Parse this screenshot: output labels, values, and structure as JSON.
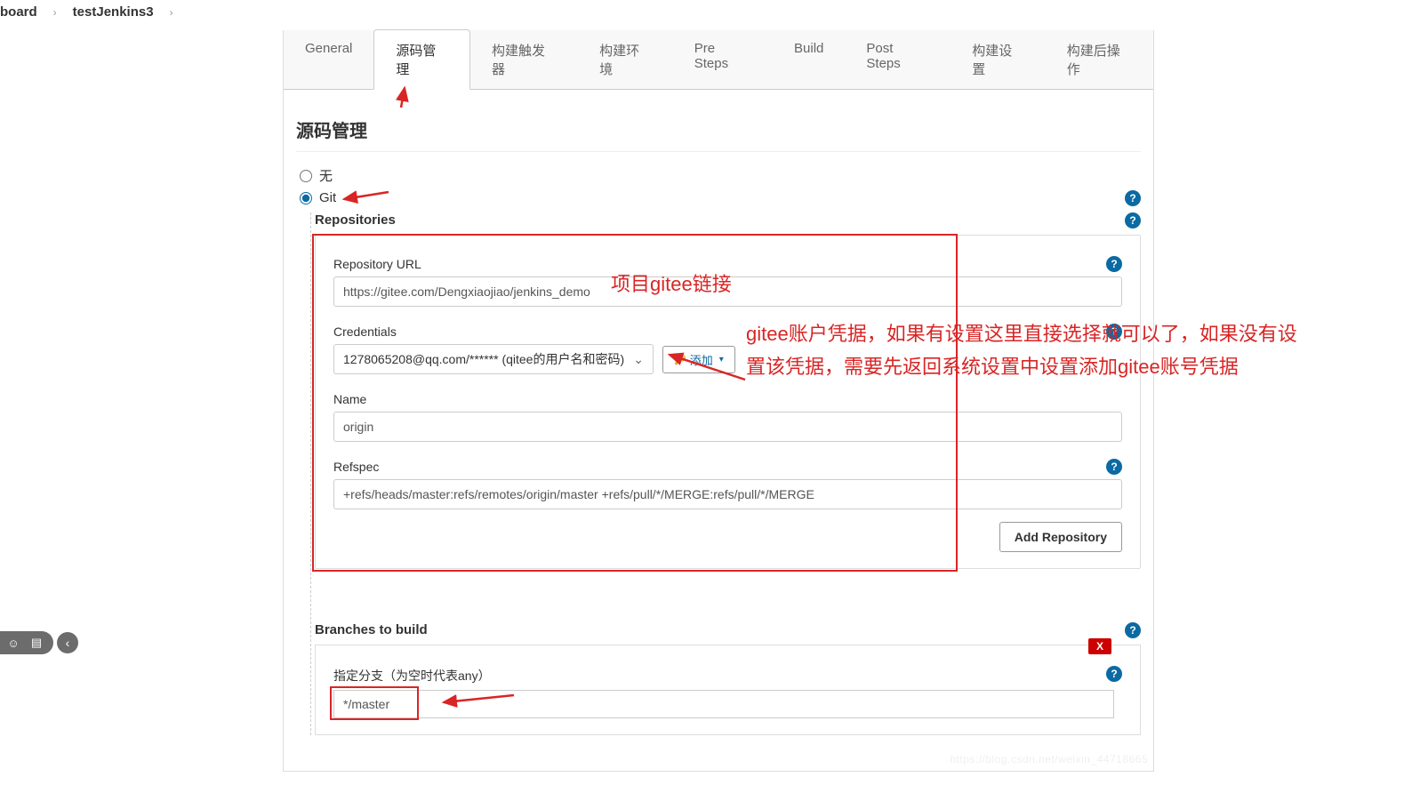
{
  "breadcrumb": {
    "item1": "board",
    "item2": "testJenkins3"
  },
  "tabs": {
    "general": "General",
    "scm": "源码管理",
    "triggers": "构建触发器",
    "env": "构建环境",
    "presteps": "Pre Steps",
    "build": "Build",
    "poststeps": "Post Steps",
    "settings": "构建设置",
    "postbuild": "构建后操作"
  },
  "scm": {
    "heading": "源码管理",
    "none_label": "无",
    "git_label": "Git",
    "repositories_title": "Repositories",
    "repo_url_label": "Repository URL",
    "repo_url_value": "https://gitee.com/Dengxiaojiao/jenkins_demo",
    "credentials_label": "Credentials",
    "credentials_value": "1278065208@qq.com/****** (qitee的用户名和密码)",
    "add_label": "添加",
    "name_label": "Name",
    "name_value": "origin",
    "refspec_label": "Refspec",
    "refspec_value": "+refs/heads/master:refs/remotes/origin/master +refs/pull/*/MERGE:refs/pull/*/MERGE",
    "add_repo_label": "Add Repository",
    "branches_title": "Branches to build",
    "branch_spec_label": "指定分支（为空时代表any）",
    "branch_spec_value": "*/master",
    "delete_x": "X"
  },
  "annotations": {
    "gitee_link": "项目gitee链接",
    "gitee_cred": "gitee账户凭据，如果有设置这里直接选择就可以了，如果没有设置该凭据，需要先返回系统设置中设置添加gitee账号凭据"
  },
  "watermark": "https://blog.csdn.net/weixin_44718665"
}
